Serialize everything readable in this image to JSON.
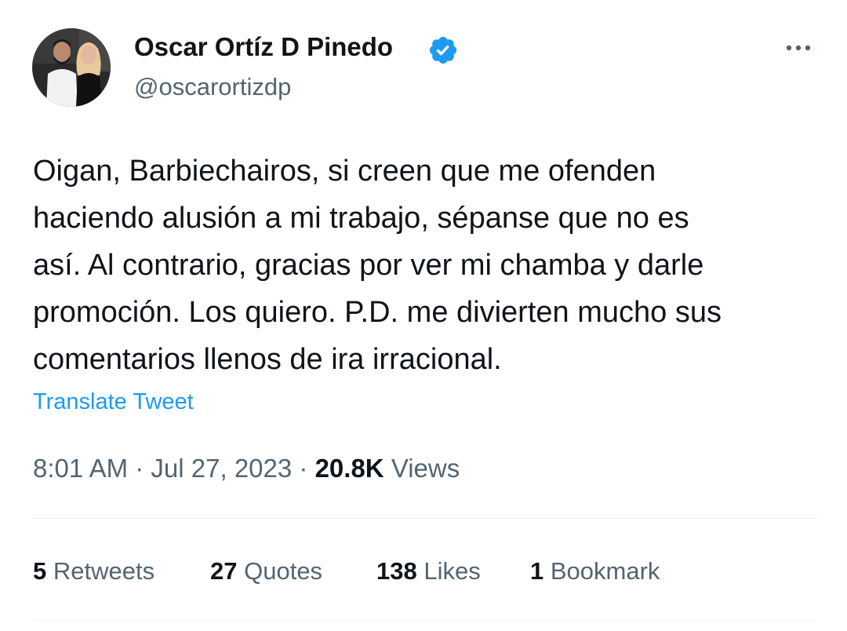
{
  "author": {
    "display_name": "Oscar Ortíz D Pinedo",
    "handle": "@oscarortizdp",
    "verified_icon": "verified-badge-icon"
  },
  "tweet": {
    "lines": [
      "Oigan, Barbiechairos, si creen que me ofenden",
      "haciendo alusión a mi trabajo, sépanse que no es",
      "así. Al contrario, gracias por ver mi chamba y darle",
      "promoción. Los quiero. P.D. me divierten mucho sus",
      "comentarios llenos de ira irracional."
    ],
    "translate_label": "Translate Tweet"
  },
  "meta": {
    "time": "8:01 AM",
    "separator": "·",
    "date": "Jul 27, 2023",
    "views_count": "20.8K",
    "views_label": "Views"
  },
  "stats": {
    "retweets_count": "5",
    "retweets_label": "Retweets",
    "quotes_count": "27",
    "quotes_label": "Quotes",
    "likes_count": "138",
    "likes_label": "Likes",
    "bookmarks_count": "1",
    "bookmarks_label": "Bookmark"
  },
  "colors": {
    "primary_text": "#0f1419",
    "secondary_text": "#536471",
    "accent": "#1d9bf0",
    "divider": "#eff3f4"
  }
}
